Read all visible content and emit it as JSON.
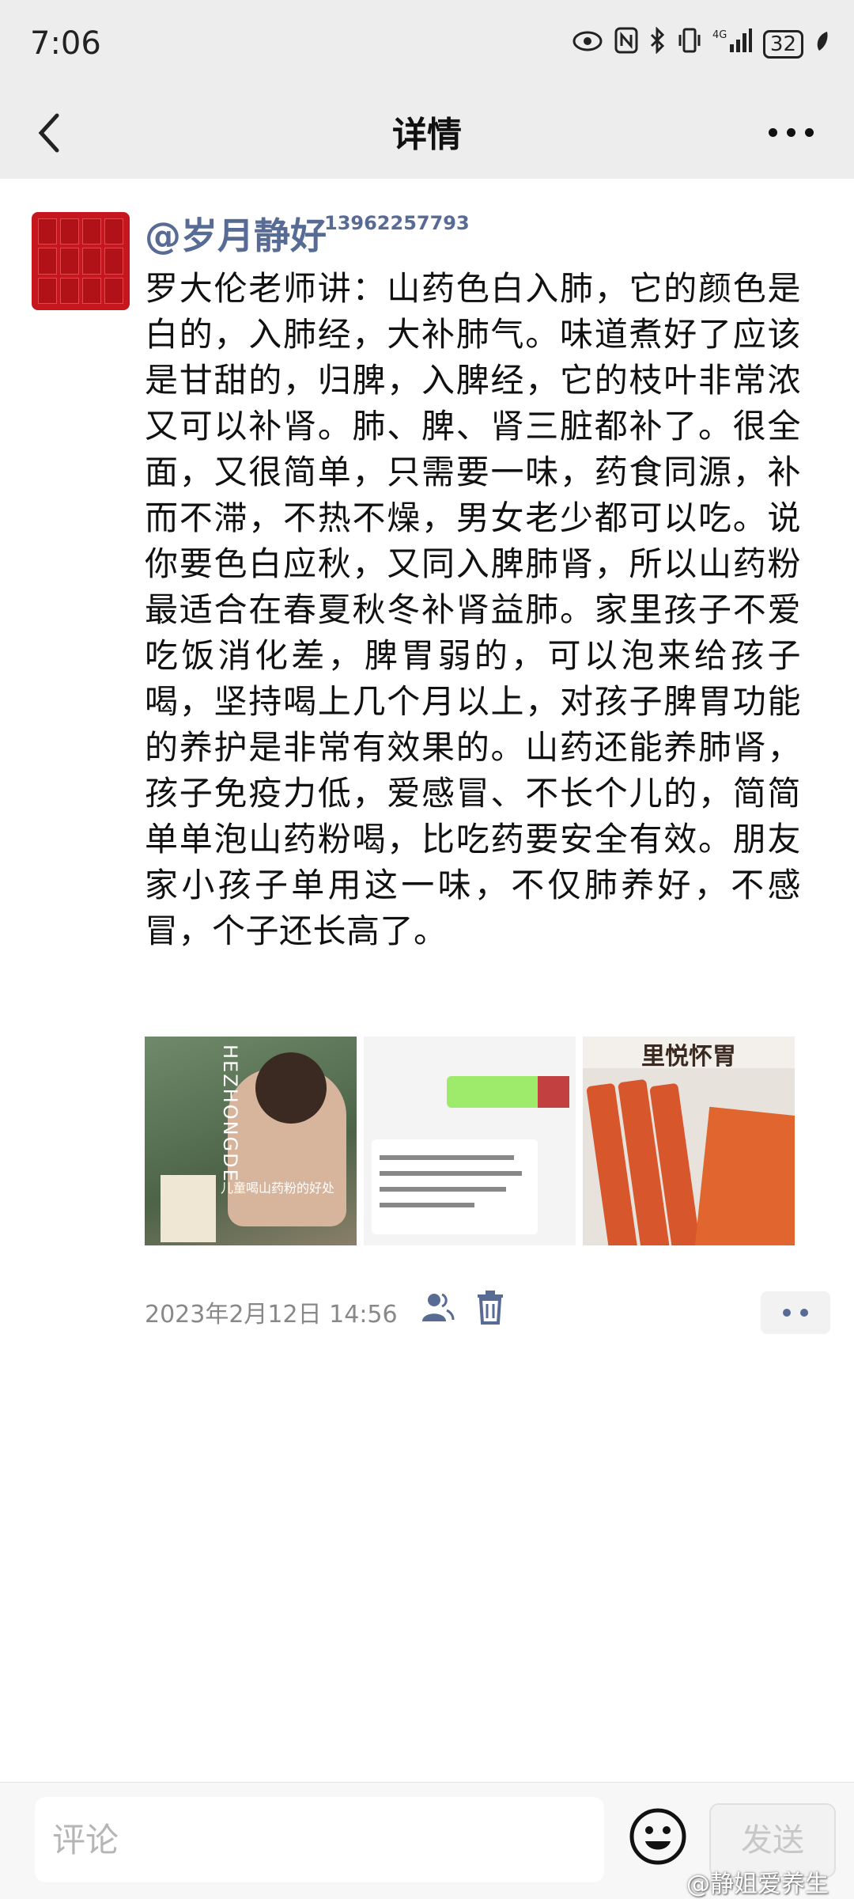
{
  "status_bar": {
    "time": "7:06",
    "signal_label": "4G",
    "battery": "32"
  },
  "nav": {
    "title": "详情"
  },
  "post": {
    "author": "@岁月静好",
    "author_phone": "13962257793",
    "text": "罗大伦老师讲：山药色白入肺，它的颜色是白的，入肺经，大补肺气。味道煮好了应该是甘甜的，归脾，入脾经，它的枝叶非常浓又可以补肾。肺、脾、肾三脏都补了。很全面，又很简单，只需要一味，药食同源，补而不滞，不热不燥，男女老少都可以吃。说你要色白应秋，又同入脾肺肾，所以山药粉最适合在春夏秋冬补肾益肺。家里孩子不爱吃饭消化差，脾胃弱的，可以泡来给孩子喝，坚持喝上几个月以上，对孩子脾胃功能的养护是非常有效果的。山药还能养肺肾，孩子免疫力低，爱感冒、不长个儿的，简简单单泡山药粉喝，比吃药要安全有效。朋友家小孩子单用这一味，不仅肺养好，不感冒，个子还长高了。",
    "photo1_brand": "HEZHONGDE",
    "photo1_caption": "儿童喝山药粉的好处",
    "photo3_header": "里悦怀胃",
    "timestamp": "2023年2月12日 14:56"
  },
  "comment": {
    "placeholder": "评论",
    "send_label": "发送"
  },
  "watermark": "@静姐爱养生",
  "colors": {
    "link": "#576b95",
    "header_bg": "#ededed"
  }
}
